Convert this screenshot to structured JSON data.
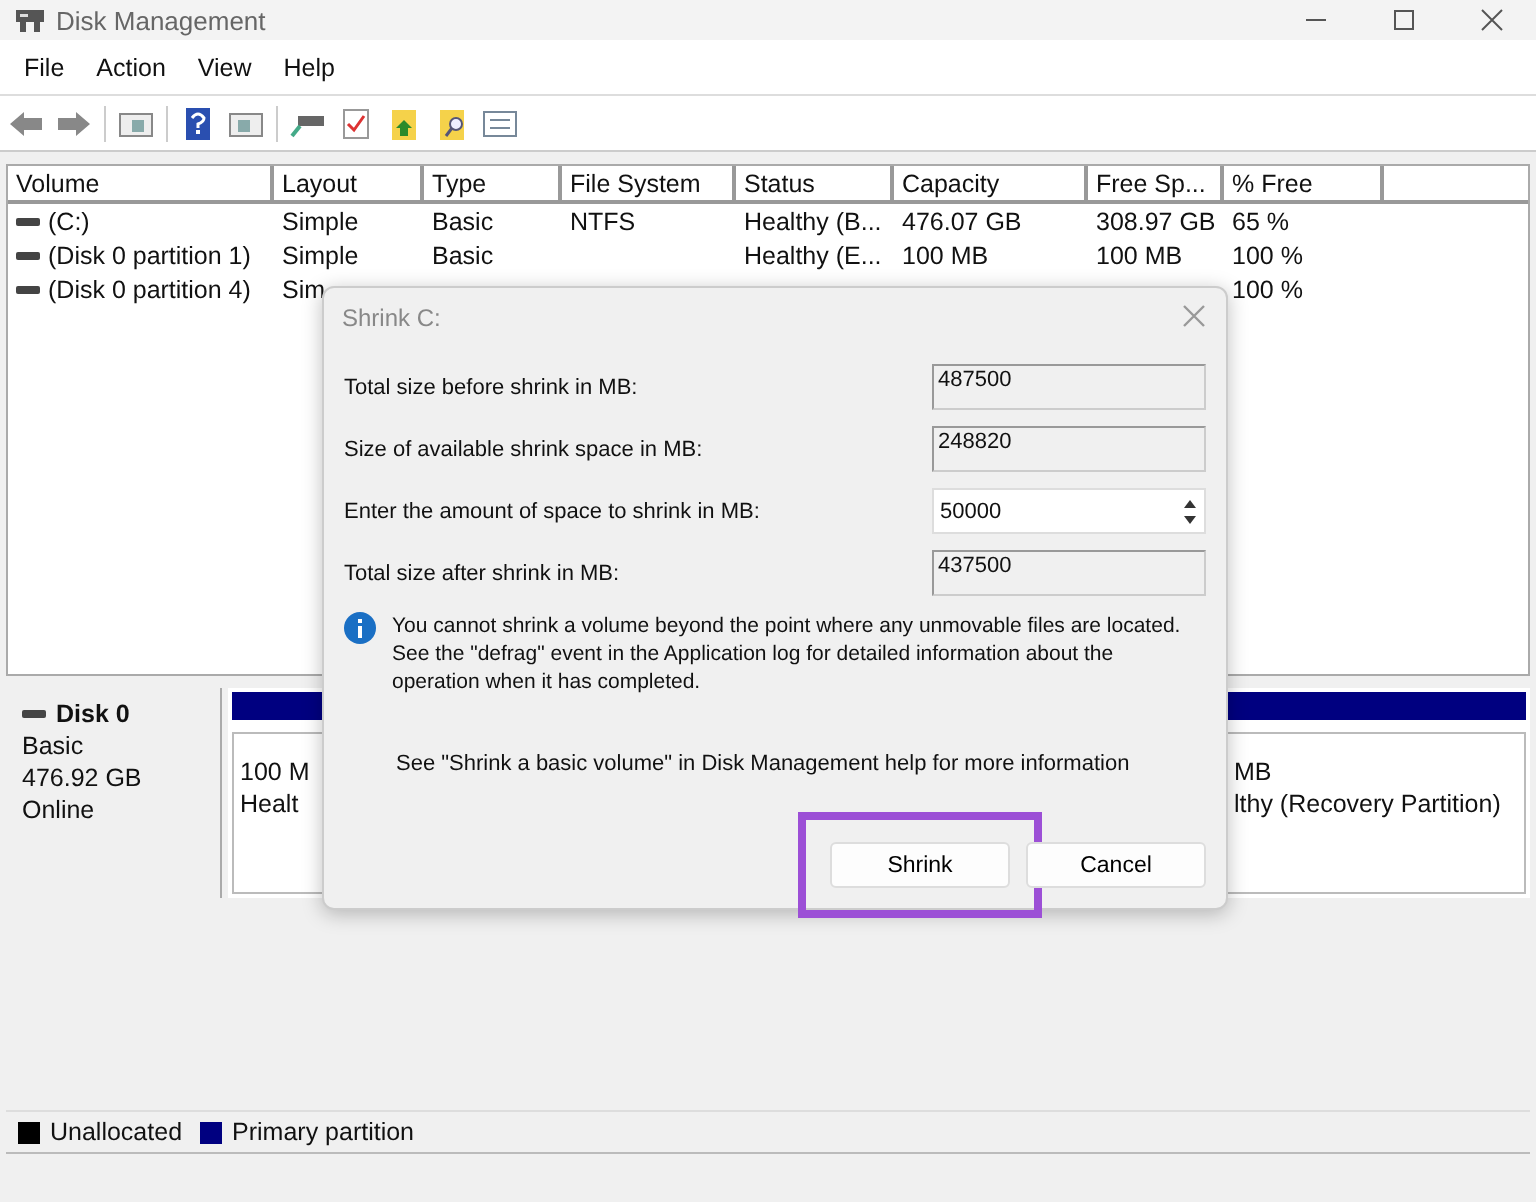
{
  "window": {
    "title": "Disk Management"
  },
  "menu": [
    "File",
    "Action",
    "View",
    "Help"
  ],
  "table": {
    "columns": [
      "Volume",
      "Layout",
      "Type",
      "File System",
      "Status",
      "Capacity",
      "Free Sp...",
      "% Free"
    ],
    "rows": [
      {
        "cells": [
          "(C:)",
          "Simple",
          "Basic",
          "NTFS",
          "Healthy (B...",
          "476.07 GB",
          "308.97 GB",
          "65 %"
        ]
      },
      {
        "cells": [
          "(Disk 0 partition 1)",
          "Simple",
          "Basic",
          "",
          "Healthy (E...",
          "100 MB",
          "100 MB",
          "100 %"
        ]
      },
      {
        "cells": [
          "(Disk 0 partition 4)",
          "Sim",
          "",
          "",
          "",
          "",
          "",
          "100 %"
        ]
      }
    ]
  },
  "disk": {
    "name": "Disk 0",
    "type": "Basic",
    "size": "476.92 GB",
    "state": "Online",
    "partitions": [
      {
        "lines": [
          "100 M",
          "Healt"
        ]
      },
      {
        "lines": [
          "MB",
          "lthy (Recovery Partition)"
        ]
      }
    ]
  },
  "legend": [
    {
      "label": "Unallocated",
      "color": "#000000"
    },
    {
      "label": "Primary partition",
      "color": "#000080"
    }
  ],
  "dialog": {
    "title": "Shrink C:",
    "fields": [
      {
        "label": "Total size before shrink in MB:",
        "value": "487500",
        "kind": "readonly"
      },
      {
        "label": "Size of available shrink space in MB:",
        "value": "248820",
        "kind": "readonly"
      },
      {
        "label": "Enter the amount of space to shrink in MB:",
        "value": "50000",
        "kind": "spin"
      },
      {
        "label": "Total size after shrink in MB:",
        "value": "437500",
        "kind": "readonly"
      }
    ],
    "info": "You cannot shrink a volume beyond the point where any unmovable files are located. See the \"defrag\" event in the Application log for detailed information about the operation when it has completed.",
    "help": "See \"Shrink a basic volume\" in Disk Management help for more information",
    "buttons": [
      {
        "label": "Shrink",
        "highlighted": true
      },
      {
        "label": "Cancel",
        "highlighted": false
      }
    ]
  }
}
